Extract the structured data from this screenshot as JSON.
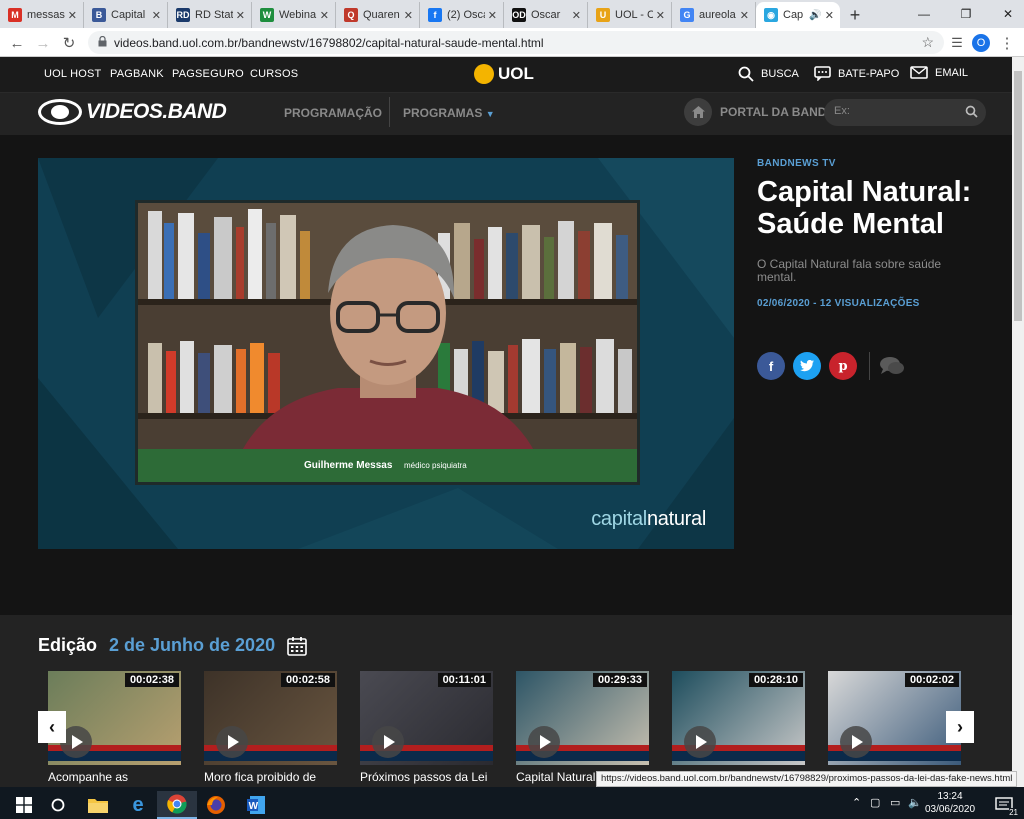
{
  "browser": {
    "tabs": [
      {
        "label": "messas",
        "icon": "gmail-icon",
        "color": "#d93025",
        "glyph": "M"
      },
      {
        "label": "Capital",
        "icon": "band-icon",
        "color": "#3b5998",
        "glyph": "B"
      },
      {
        "label": "RD Stati",
        "icon": "rd-icon",
        "color": "#1b3a6b",
        "glyph": "RD"
      },
      {
        "label": "Webina",
        "icon": "webinar-icon",
        "color": "#1e8e3e",
        "glyph": "W"
      },
      {
        "label": "Quaren",
        "icon": "quarentena-icon",
        "color": "#c0392b",
        "glyph": "Q"
      },
      {
        "label": "(2) Osca",
        "icon": "facebook-icon",
        "color": "#1877f2",
        "glyph": "f"
      },
      {
        "label": "Oscar",
        "icon": "od-icon",
        "color": "#111111",
        "glyph": "OD"
      },
      {
        "label": "UOL - C",
        "icon": "uol-icon",
        "color": "#e8a317",
        "glyph": "U"
      },
      {
        "label": "aureola",
        "icon": "google-icon",
        "color": "#4285f4",
        "glyph": "G"
      },
      {
        "label": "Cap",
        "icon": "videos-band-icon",
        "color": "#2aa7e0",
        "glyph": "◉",
        "active": true
      }
    ],
    "url": "videos.band.uol.com.br/bandnewstv/16798802/capital-natural-saude-mental.html",
    "profile_initial": "O",
    "status_url": "https://videos.band.uol.com.br/bandnewstv/16798829/proximos-passos-da-lei-das-fake-news.html"
  },
  "uol_bar": {
    "links": [
      "UOL HOST",
      "PAGBANK",
      "PAGSEGURO",
      "CURSOS"
    ],
    "logo": "UOL",
    "busca": "BUSCA",
    "bate_papo": "BATE-PAPO",
    "email": "EMAIL"
  },
  "band_bar": {
    "logo": "VIDEOS.BAND",
    "programacao": "PROGRAMAÇÃO",
    "programas": "PROGRAMAS",
    "portal": "PORTAL DA BAND",
    "search_placeholder": "Ex:"
  },
  "video": {
    "person_name": "Guilherme Messas",
    "person_role": "médico psiquiatra",
    "brand_part1": "capital",
    "brand_part2": "natural"
  },
  "info": {
    "kicker": "BANDNEWS TV",
    "title": "Capital Natural: Saúde Mental",
    "description": "O Capital Natural fala sobre saúde mental.",
    "meta": "02/06/2020 - 12 VISUALIZAÇÕES"
  },
  "edition": {
    "label": "Edição",
    "date": "2 de Junho de 2020"
  },
  "thumbs": [
    {
      "duration": "00:02:38",
      "title": "Acompanhe as principais"
    },
    {
      "duration": "00:02:58",
      "title": "Moro fica proibido de"
    },
    {
      "duration": "00:11:01",
      "title": "Próximos passos da Lei"
    },
    {
      "duration": "00:29:33",
      "title": "Capital Natural:"
    },
    {
      "duration": "00:28:10",
      "title": ""
    },
    {
      "duration": "00:02:02",
      "title": ""
    }
  ],
  "taskbar": {
    "time": "13:24",
    "date": "03/06/2020",
    "notifications": "21"
  }
}
